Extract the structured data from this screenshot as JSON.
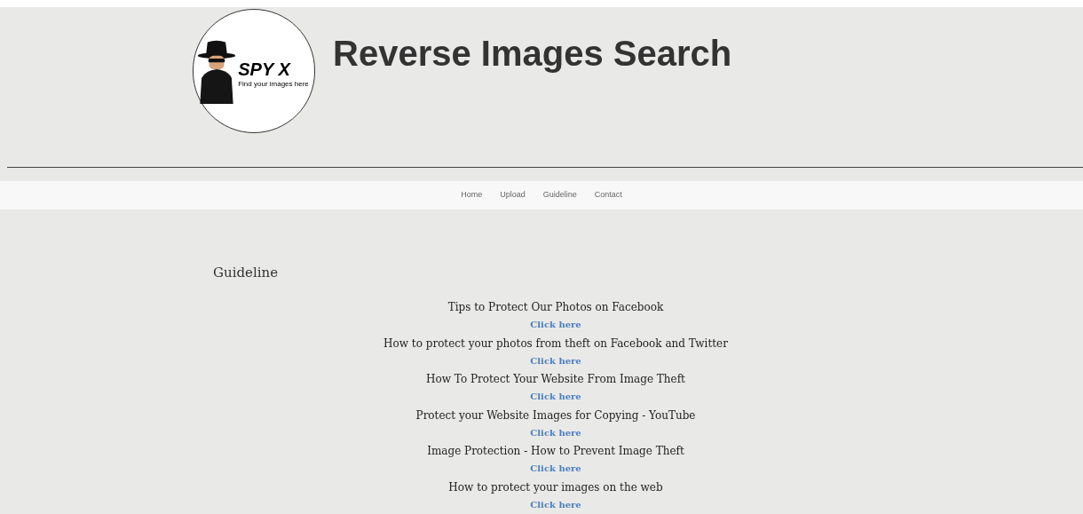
{
  "logo": {
    "brand": "SPY X",
    "tagline": "Find your images here"
  },
  "site_title": "Reverse Images Search",
  "nav": [
    {
      "label": "Home"
    },
    {
      "label": "Upload"
    },
    {
      "label": "Guideline"
    },
    {
      "label": "Contact"
    }
  ],
  "heading": "Guideline",
  "guides": [
    {
      "title": "Tips to Protect Our Photos on Facebook",
      "link": "Click here"
    },
    {
      "title": "How to protect your photos from theft on Facebook and Twitter",
      "link": "Click here"
    },
    {
      "title": "How To Protect Your Website From Image Theft",
      "link": "Click here"
    },
    {
      "title": "Protect your Website Images for Copying - YouTube",
      "link": "Click here"
    },
    {
      "title": "Image Protection - How to Prevent Image Theft",
      "link": "Click here"
    },
    {
      "title": "How to protect your images on the web",
      "link": "Click here"
    }
  ]
}
